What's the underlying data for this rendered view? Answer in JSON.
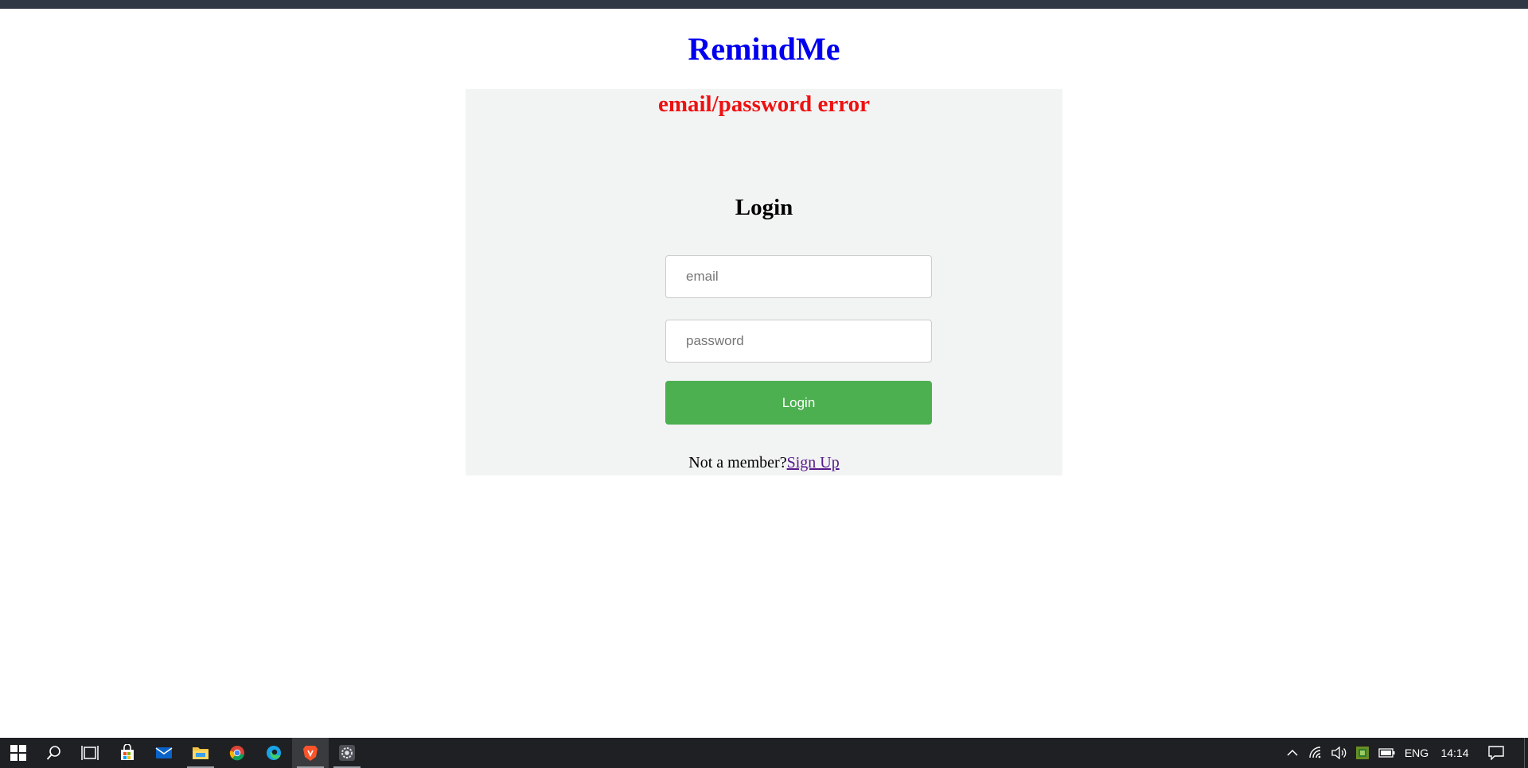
{
  "app": {
    "title": "RemindMe",
    "error_message": "email/password error"
  },
  "login_form": {
    "heading": "Login",
    "email_placeholder": "email",
    "password_placeholder": "password",
    "submit_label": "Login",
    "signup_prompt": "Not a member?",
    "signup_link": "Sign Up"
  },
  "colors": {
    "title": "#0000ee",
    "error": "#ee1111",
    "button": "#4caf50",
    "panel": "#f2f3f3",
    "link": "#551a8b"
  },
  "taskbar": {
    "apps": [
      "start-icon",
      "search-icon",
      "task-view-icon",
      "store-icon",
      "mail-icon",
      "file-explorer-icon",
      "chrome-icon",
      "edge-icon",
      "brave-icon",
      "settings-app-icon"
    ],
    "tray": {
      "language": "ENG",
      "time": "14:14"
    }
  }
}
